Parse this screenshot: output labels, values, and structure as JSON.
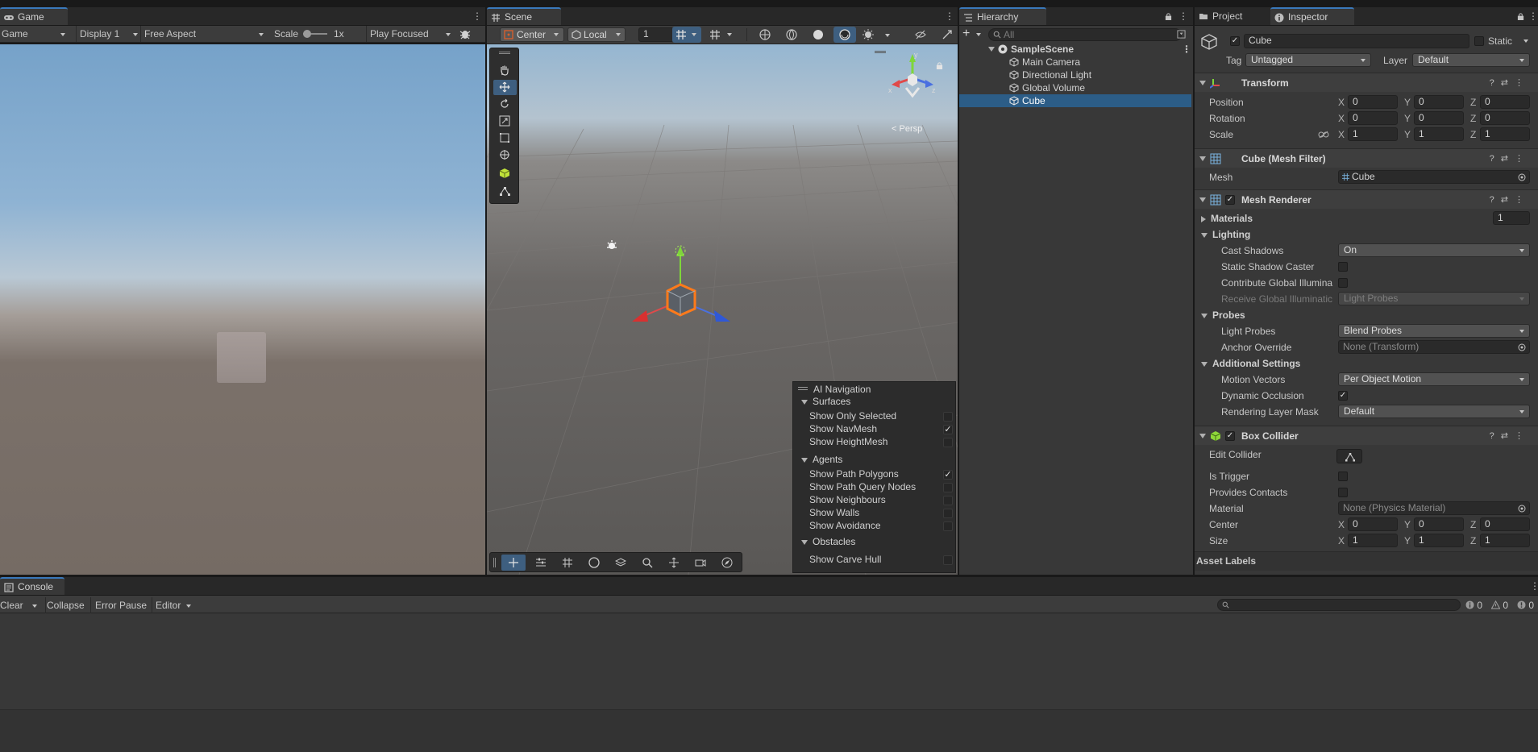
{
  "game_panel": {
    "tab": "Game",
    "mode_dropdown": "Game",
    "display_dropdown": "Display 1",
    "aspect_dropdown": "Free Aspect",
    "scale_label": "Scale",
    "scale_value": "1x",
    "play_mode_dropdown": "Play Focused"
  },
  "scene_panel": {
    "tab": "Scene",
    "pivot_dropdown": "Center",
    "space_dropdown": "Local",
    "grid_snap_value": "1",
    "persp_label": "Persp",
    "gizmo_axes": [
      "y",
      "x",
      "z"
    ],
    "tools": [
      "hand-tool",
      "move-tool",
      "rotate-tool",
      "scale-tool",
      "rect-tool",
      "transform-tool",
      "custom-tool",
      "spline-tool"
    ],
    "ai_navigation": {
      "title": "AI Navigation",
      "sections": [
        {
          "name": "Surfaces",
          "items": [
            {
              "label": "Show Only Selected",
              "checked": false
            },
            {
              "label": "Show NavMesh",
              "checked": true
            },
            {
              "label": "Show HeightMesh",
              "checked": false
            }
          ]
        },
        {
          "name": "Agents",
          "items": [
            {
              "label": "Show Path Polygons",
              "checked": true
            },
            {
              "label": "Show Path Query Nodes",
              "checked": false
            },
            {
              "label": "Show Neighbours",
              "checked": false
            },
            {
              "label": "Show Walls",
              "checked": false
            },
            {
              "label": "Show Avoidance",
              "checked": false
            }
          ]
        },
        {
          "name": "Obstacles",
          "items": [
            {
              "label": "Show Carve Hull",
              "checked": false
            }
          ]
        }
      ]
    }
  },
  "hierarchy": {
    "tab": "Hierarchy",
    "add_button": "+",
    "search_placeholder": "All",
    "scene_name": "SampleScene",
    "items": [
      "Main Camera",
      "Directional Light",
      "Global Volume",
      "Cube"
    ],
    "selected": "Cube"
  },
  "inspector": {
    "tabs": [
      "Project",
      "Inspector"
    ],
    "object_name": "Cube",
    "static_label": "Static",
    "tag_label": "Tag",
    "tag_value": "Untagged",
    "layer_label": "Layer",
    "layer_value": "Default",
    "transform": {
      "title": "Transform",
      "rows": [
        {
          "label": "Position",
          "x": "0",
          "y": "0",
          "z": "0"
        },
        {
          "label": "Rotation",
          "x": "0",
          "y": "0",
          "z": "0"
        },
        {
          "label": "Scale",
          "x": "1",
          "y": "1",
          "z": "1"
        }
      ]
    },
    "mesh_filter": {
      "title": "Cube (Mesh Filter)",
      "mesh_label": "Mesh",
      "mesh_value": "Cube"
    },
    "mesh_renderer": {
      "title": "Mesh Renderer",
      "materials_label": "Materials",
      "materials_count": "1",
      "lighting_label": "Lighting",
      "cast_shadows_label": "Cast Shadows",
      "cast_shadows_value": "On",
      "static_shadow_caster_label": "Static Shadow Caster",
      "contribute_gi_label": "Contribute Global Illumina",
      "receive_gi_label": "Receive Global Illuminatic",
      "receive_gi_value": "Light Probes",
      "probes_label": "Probes",
      "light_probes_label": "Light Probes",
      "light_probes_value": "Blend Probes",
      "anchor_override_label": "Anchor Override",
      "anchor_override_value": "None (Transform)",
      "additional_settings_label": "Additional Settings",
      "motion_vectors_label": "Motion Vectors",
      "motion_vectors_value": "Per Object Motion",
      "dynamic_occlusion_label": "Dynamic Occlusion",
      "rendering_layer_mask_label": "Rendering Layer Mask",
      "rendering_layer_mask_value": "Default"
    },
    "box_collider": {
      "title": "Box Collider",
      "edit_collider_label": "Edit Collider",
      "is_trigger_label": "Is Trigger",
      "provides_contacts_label": "Provides Contacts",
      "material_label": "Material",
      "material_value": "None (Physics Material)",
      "center": {
        "label": "Center",
        "x": "0",
        "y": "0",
        "z": "0"
      },
      "size": {
        "label": "Size",
        "x": "1",
        "y": "1",
        "z": "1"
      }
    },
    "asset_labels": "Asset Labels"
  },
  "console": {
    "tab": "Console",
    "clear": "Clear",
    "collapse": "Collapse",
    "error_pause": "Error Pause",
    "editor": "Editor",
    "log_count": "0",
    "warning_count": "0",
    "error_count": "0"
  },
  "colors": {
    "accent": "#3a79bb",
    "selection": "#2c5d87",
    "panel_bg": "#383838",
    "nav_check": "#e0e0e0"
  }
}
